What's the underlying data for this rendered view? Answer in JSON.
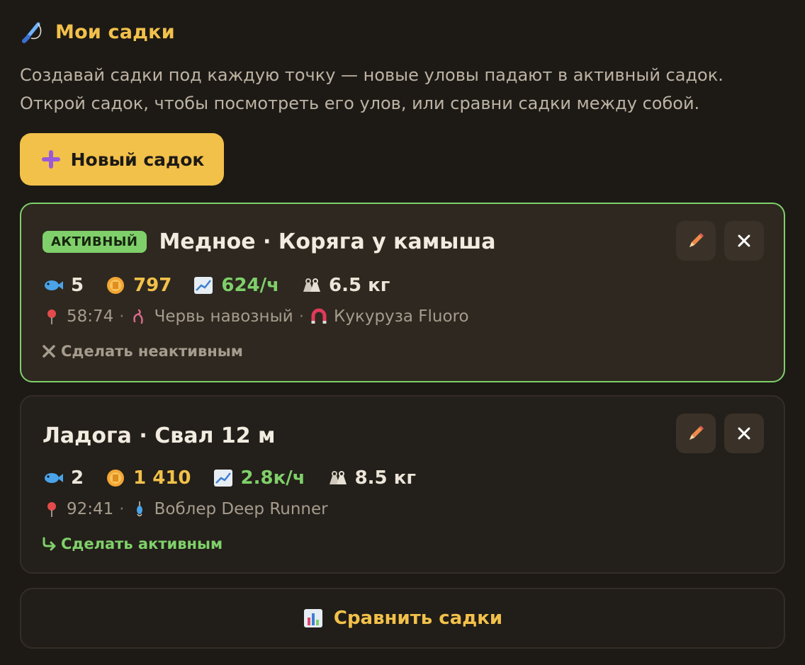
{
  "header": {
    "icon": "fishing-rod-icon",
    "title": "Мои садки"
  },
  "description": "Создавай садки под каждую точку — новые уловы падают в активный садок. Открой садок, чтобы посмотреть его улов, или сравни садки между собой.",
  "new_button": {
    "icon": "plus-icon",
    "label": "Новый садок"
  },
  "colors": {
    "accent": "#f2c14a",
    "active_green": "#7fd06a",
    "background": "#1d1a16"
  },
  "keepnets": [
    {
      "active": true,
      "badge": "АКТИВНЫЙ",
      "title": "Медное · Коряга у камыша",
      "stats": {
        "count": "5",
        "coins": "797",
        "rate": "624/ч",
        "weight": "6.5 кг"
      },
      "meta": {
        "coords": "58:74",
        "bait": "Червь навозный",
        "lure": "Кукуруза Fluoro"
      },
      "toggle": "Сделать неактивным"
    },
    {
      "active": false,
      "title": "Ладога · Свал 12 м",
      "stats": {
        "count": "2",
        "coins": "1 410",
        "rate": "2.8к/ч",
        "weight": "8.5 кг"
      },
      "meta": {
        "coords": "92:41",
        "tackle": "Воблер Deep Runner"
      },
      "toggle": "Сделать активным"
    }
  ],
  "compare_button": {
    "icon": "bar-chart-icon",
    "label": "Сравнить садки"
  }
}
